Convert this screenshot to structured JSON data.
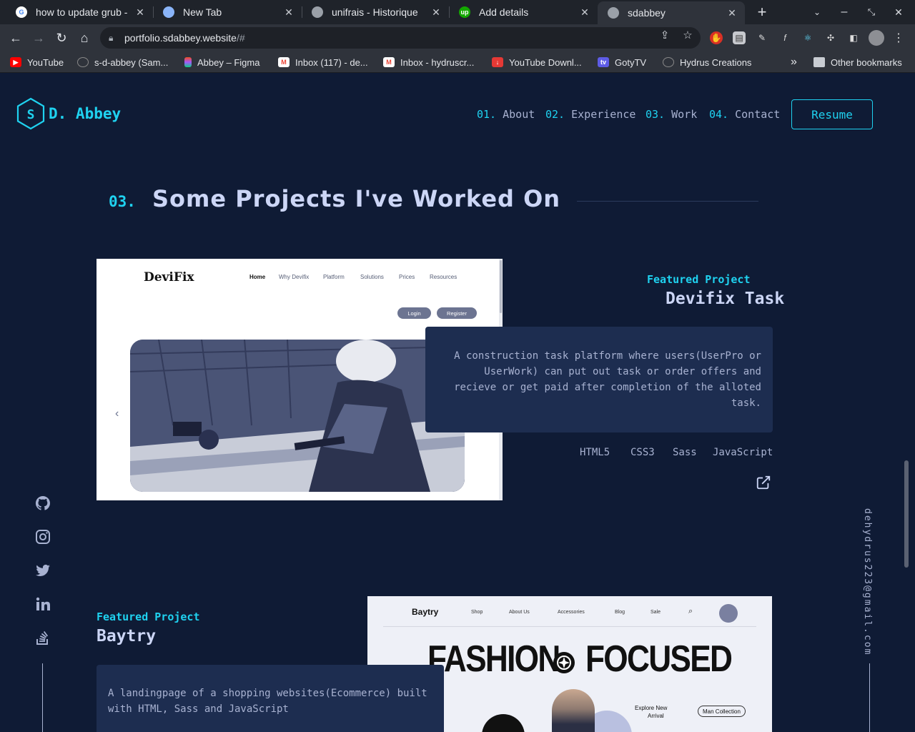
{
  "browser": {
    "tabs": [
      {
        "title": "how to update grub - ",
        "icon": "google-icon"
      },
      {
        "title": "New Tab",
        "icon": "chrome-icon"
      },
      {
        "title": "unifrais - Historique",
        "icon": "globe-icon"
      },
      {
        "title": "Add details",
        "icon": "upwork-icon"
      },
      {
        "title": "sdabbey",
        "icon": "globe-icon",
        "active": true
      }
    ],
    "new_tab_label": "+",
    "url_host": "portfolio.sdabbey.website",
    "url_rest": "/#",
    "bookmarks": [
      {
        "label": "YouTube",
        "icon": "youtube-icon"
      },
      {
        "label": "s-d-abbey (Sam...",
        "icon": "github-icon"
      },
      {
        "label": "Abbey – Figma",
        "icon": "figma-icon"
      },
      {
        "label": "Inbox (117) - de...",
        "icon": "gmail-icon"
      },
      {
        "label": "Inbox - hydruscr...",
        "icon": "gmail-icon"
      },
      {
        "label": "YouTube Downl...",
        "icon": "download-icon"
      },
      {
        "label": "GotyTV",
        "icon": "tv-icon"
      },
      {
        "label": "Hydrus Creations",
        "icon": "github-icon"
      }
    ],
    "other_bookmarks": "Other bookmarks",
    "overflow_label": "»"
  },
  "site": {
    "logo_letter": "S",
    "logo_name": "D. Abbey",
    "nav": [
      {
        "num": "01.",
        "label": "About"
      },
      {
        "num": "02.",
        "label": "Experience"
      },
      {
        "num": "03.",
        "label": "Work"
      },
      {
        "num": "04.",
        "label": "Contact"
      }
    ],
    "resume_label": "Resume",
    "section": {
      "num": "03.",
      "title": "Some Projects I've Worked On"
    },
    "projects": [
      {
        "label": "Featured Project",
        "title": "Devifix Task",
        "description": "A construction task platform where users(UserPro or UserWork) can put out task or order offers and recieve or get paid after completion of the alloted task.",
        "tech": [
          "HTML5",
          "CSS3",
          "Sass",
          "JavaScript"
        ],
        "preview": {
          "brand": "DeviFix",
          "nav": [
            "Home",
            "Why Devifix",
            "Platform",
            "Solutions",
            "Prices",
            "Resources"
          ],
          "buttons": [
            "Login",
            "Register"
          ],
          "arrow": "‹"
        }
      },
      {
        "label": "Featured Project",
        "title": "Baytry",
        "description": "A landingpage of a shopping websites(Ecommerce) built with HTML, Sass and JavaScript",
        "preview": {
          "brand": "Baytry",
          "nav": [
            "Shop",
            "About Us",
            "Accessories",
            "Blog",
            "Sale"
          ],
          "headline_left": "FASHION",
          "headline_right": "FOCUSED",
          "explore_line1": "Explore New",
          "explore_line2": "Arrival",
          "chip": "Man Collection"
        }
      }
    ],
    "email": "dehydrus223@gmail.com",
    "socials": [
      "github-icon",
      "instagram-icon",
      "twitter-icon",
      "linkedin-icon",
      "stackoverflow-icon"
    ],
    "accent_color": "#1fd2f0",
    "bg_color": "#0f1b35"
  }
}
